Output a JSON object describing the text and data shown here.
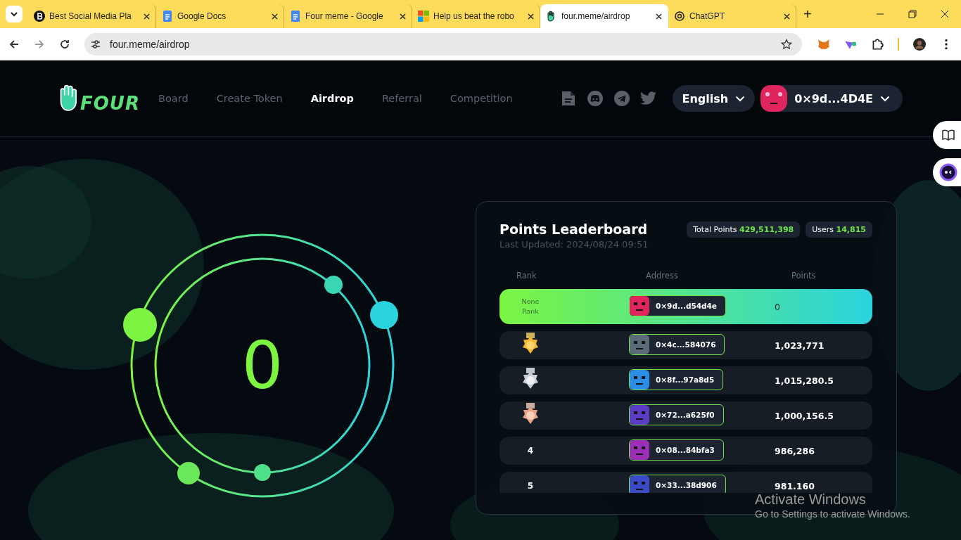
{
  "browser": {
    "tabs": [
      {
        "title": "Best Social Media Pla",
        "selected": false
      },
      {
        "title": "Google Docs",
        "selected": false
      },
      {
        "title": "Four meme - Google",
        "selected": false
      },
      {
        "title": "Help us beat the robo",
        "selected": false
      },
      {
        "title": "four.meme/airdrop",
        "selected": true
      },
      {
        "title": "ChatGPT",
        "selected": false
      }
    ],
    "new_tab": "+",
    "address": "four.meme/airdrop"
  },
  "nav": {
    "logo": "FOUR",
    "links": [
      {
        "label": "Board",
        "selected": false
      },
      {
        "label": "Create Token",
        "selected": false
      },
      {
        "label": "Airdrop",
        "selected": true
      },
      {
        "label": "Referral",
        "selected": false
      },
      {
        "label": "Competition",
        "selected": false
      }
    ],
    "language": "English",
    "wallet": "0×9d...4D4E"
  },
  "points_display": "0",
  "leaderboard": {
    "title": "Points Leaderboard",
    "updated": "Last Updated: 2024/08/24 09:51",
    "total_label": "Total Points",
    "total": "429,511,398",
    "users_label": "Users",
    "users": "14,815",
    "columns": [
      "Rank",
      "Address",
      "Points"
    ],
    "rows": [
      {
        "kind": "self",
        "rank": "None Rank",
        "address": "0×9d...d54d4e",
        "points": "0",
        "color": "#e0245e"
      },
      {
        "kind": "gold",
        "address": "0×4c...584076",
        "points": "1,023,771",
        "color": "#5c6b78"
      },
      {
        "kind": "silver",
        "address": "0×8f...97a8d5",
        "points": "1,015,280.5",
        "color": "#2a8de6"
      },
      {
        "kind": "bronze",
        "address": "0×72...a625f0",
        "points": "1,000,156.5",
        "color": "#5b3cc4"
      },
      {
        "kind": "number",
        "rank": "4",
        "address": "0×08...84bfa3",
        "points": "986,286",
        "color": "#9b2fb8"
      },
      {
        "kind": "number",
        "rank": "5",
        "address": "0×33...38d906",
        "points": "981.160",
        "color": "#3b4bc8"
      }
    ]
  },
  "os_notice": {
    "title": "Activate Windows",
    "text": "Go to Settings to activate Windows."
  }
}
